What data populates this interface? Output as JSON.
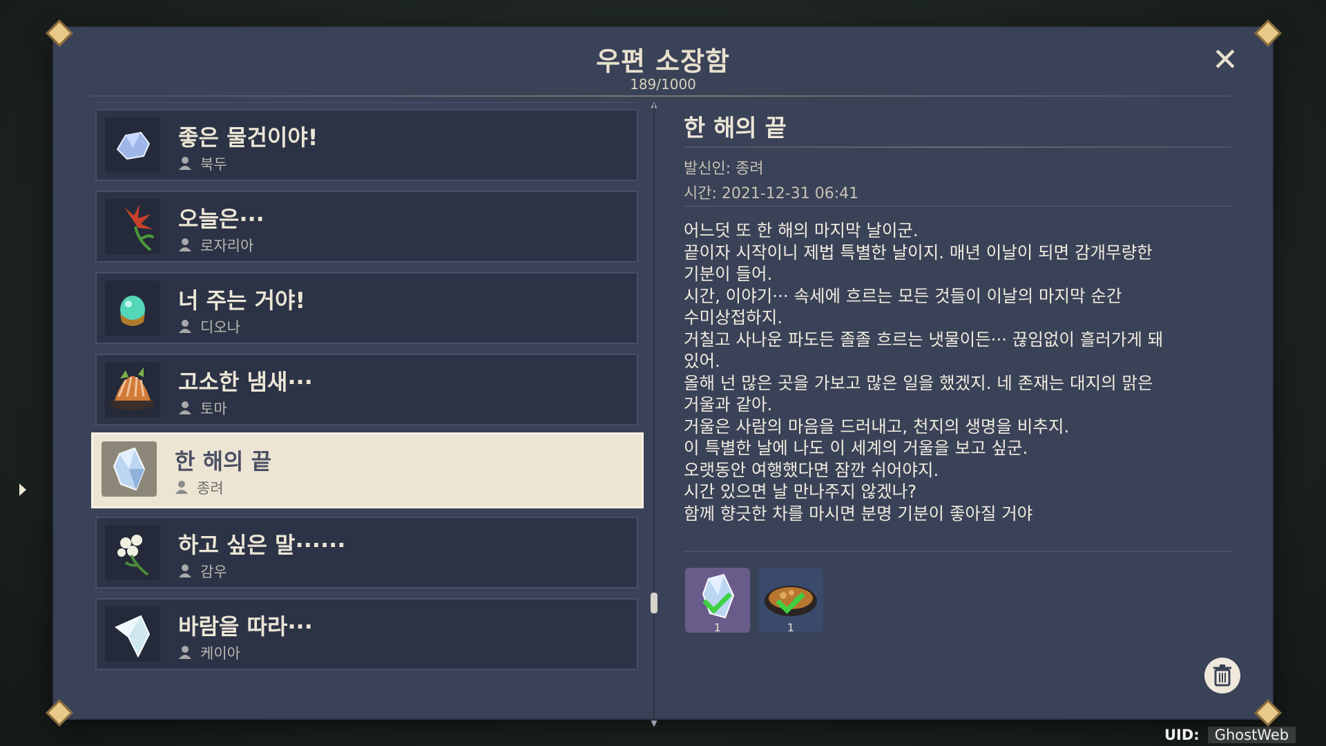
{
  "window": {
    "title": "우편 소장함",
    "count": "189/1000",
    "close_label": "✕"
  },
  "mail_list": [
    {
      "subject": "좋은 물건이야!",
      "sender": "북두",
      "icon": "crystal-ore-icon",
      "thumb_color": "#9fb6e8"
    },
    {
      "subject": "오늘은···",
      "sender": "로자리아",
      "icon": "red-flower-icon",
      "thumb_color": "#c8402a"
    },
    {
      "subject": "너 주는 거야!",
      "sender": "디오나",
      "icon": "green-orb-icon",
      "thumb_color": "#54d6b8"
    },
    {
      "subject": "고소한 냄새···",
      "sender": "토마",
      "icon": "grilled-dish-icon",
      "thumb_color": "#d27a3a"
    },
    {
      "subject": "한 해의 끝",
      "sender": "종려",
      "icon": "crystal-chunk-icon",
      "thumb_color": "#bcd6f2",
      "selected": true
    },
    {
      "subject": "하고 싶은 말······",
      "sender": "감우",
      "icon": "white-flower-icon",
      "thumb_color": "#f0f0e0"
    },
    {
      "subject": "바람을 따라···",
      "sender": "케이아",
      "icon": "ice-crystal-icon",
      "thumb_color": "#cfe8f0"
    }
  ],
  "detail": {
    "title": "한 해의 끝",
    "sender": "발신인: 종려",
    "time": "시간: 2021-12-31 06:41",
    "body": "어느덧 또 한 해의 마지막 날이군.\n끝이자 시작이니 제법 특별한 날이지. 매년 이날이 되면 감개무량한\n기분이 들어.\n시간, 이야기··· 속세에 흐르는 모든 것들이 이날의 마지막 순간\n수미상접하지.\n거칠고 사나운 파도든 졸졸 흐르는 냇물이든··· 끊임없이 흘러가게 돼\n있어.\n올해 넌 많은 곳을 가보고 많은 일을 했겠지. 네 존재는 대지의 맑은\n거울과 같아.\n거울은 사람의 마음을 드러내고, 천지의 생명을 비추지.\n이 특별한 날에 나도 이 세계의 거울을 보고 싶군.\n오랫동안 여행했다면 잠깐 쉬어야지.\n시간 있으면 날 만나주지 않겠나?\n함께 향긋한 차를 마시면 분명 기분이 좋아질 거야"
  },
  "attachments": [
    {
      "icon": "crystal-chunk-icon",
      "qty": "1",
      "claimed": true,
      "bg": "#6a5c8a"
    },
    {
      "icon": "stew-dish-icon",
      "qty": "1",
      "claimed": true,
      "bg": "#3a4a6a"
    }
  ],
  "footer": {
    "uid_label": "UID:",
    "uid_value": "GhostWeb"
  }
}
